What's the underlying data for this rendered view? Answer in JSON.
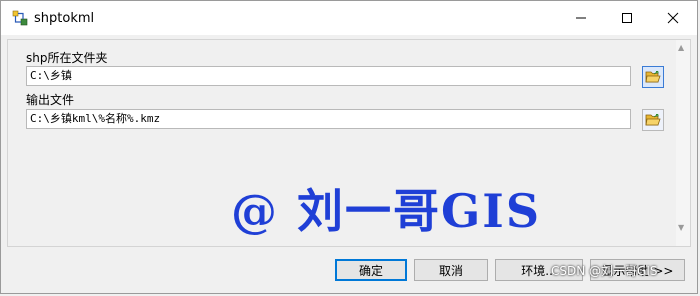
{
  "window": {
    "title": "shptokml"
  },
  "form": {
    "shp_folder_label": "shp所在文件夹",
    "shp_folder_value": "C:\\乡镇",
    "output_label": "输出文件",
    "output_value": "C:\\乡镇kml\\%名称%.kmz"
  },
  "watermark": "@ 刘一哥GIS",
  "buttons": {
    "ok": "确定",
    "cancel": "取消",
    "environment": "环境...",
    "help": "显示帮助 >>"
  },
  "footer_watermark": "CSDN @刘一哥GIS",
  "colors": {
    "watermark": "#1f3fd6",
    "default_button_border": "#0078d7"
  }
}
